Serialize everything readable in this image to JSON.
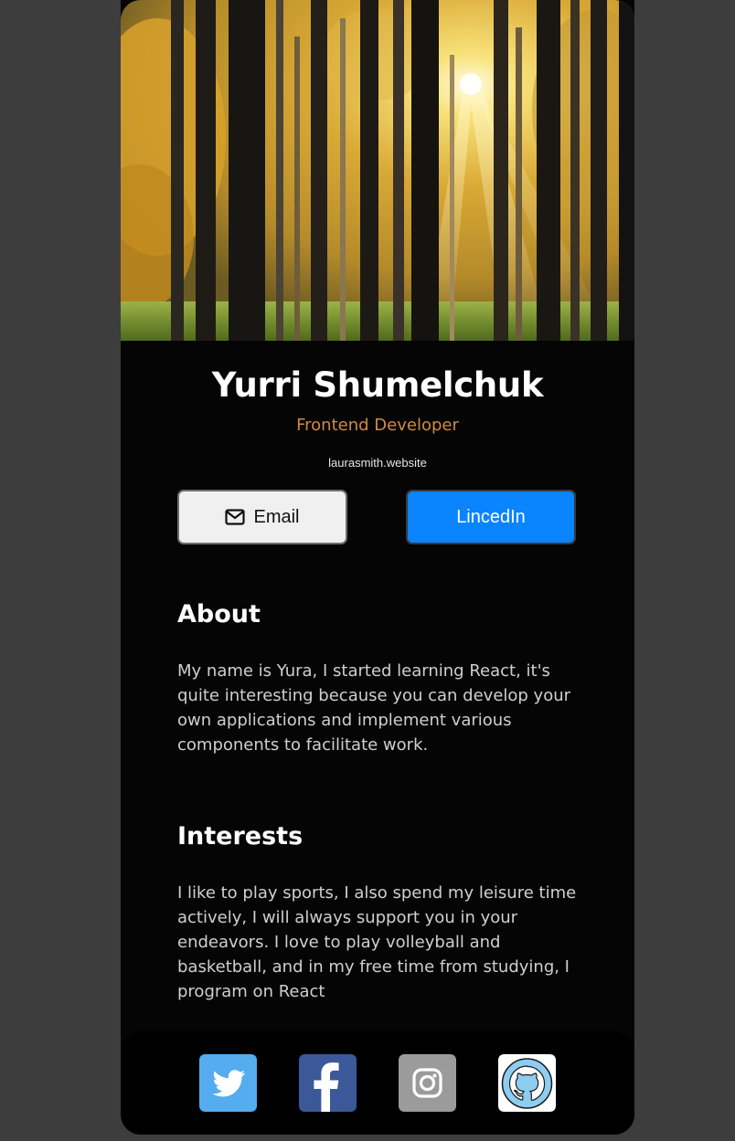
{
  "profile": {
    "name": "Yurri Shumelchuk",
    "role": "Frontend Developer",
    "website": "laurasmith.website"
  },
  "buttons": {
    "email_label": "Email",
    "linkedin_label": "LincedIn"
  },
  "about": {
    "title": "About",
    "text": "My name is Yura, I started learning React, it's quite interesting because you can develop your own applications and implement various components to facilitate work."
  },
  "interests": {
    "title": "Interests",
    "text": "I like to play sports, I also spend my leisure time actively, I will always support you in your endeavors. I love to play volleyball and basketball, and in my free time from studying, I program on React"
  },
  "social": [
    {
      "icon": "twitter-icon",
      "color": "#55acee"
    },
    {
      "icon": "facebook-icon",
      "color": "#3b5998"
    },
    {
      "icon": "instagram-icon",
      "color": "#9b9b9b"
    },
    {
      "icon": "github-icon",
      "color": "#ffffff"
    }
  ],
  "colors": {
    "page_background": "#3d3d3d",
    "card_background": "#050505",
    "role_accent": "#d08a43",
    "linkedin_blue": "#0a84ff"
  }
}
